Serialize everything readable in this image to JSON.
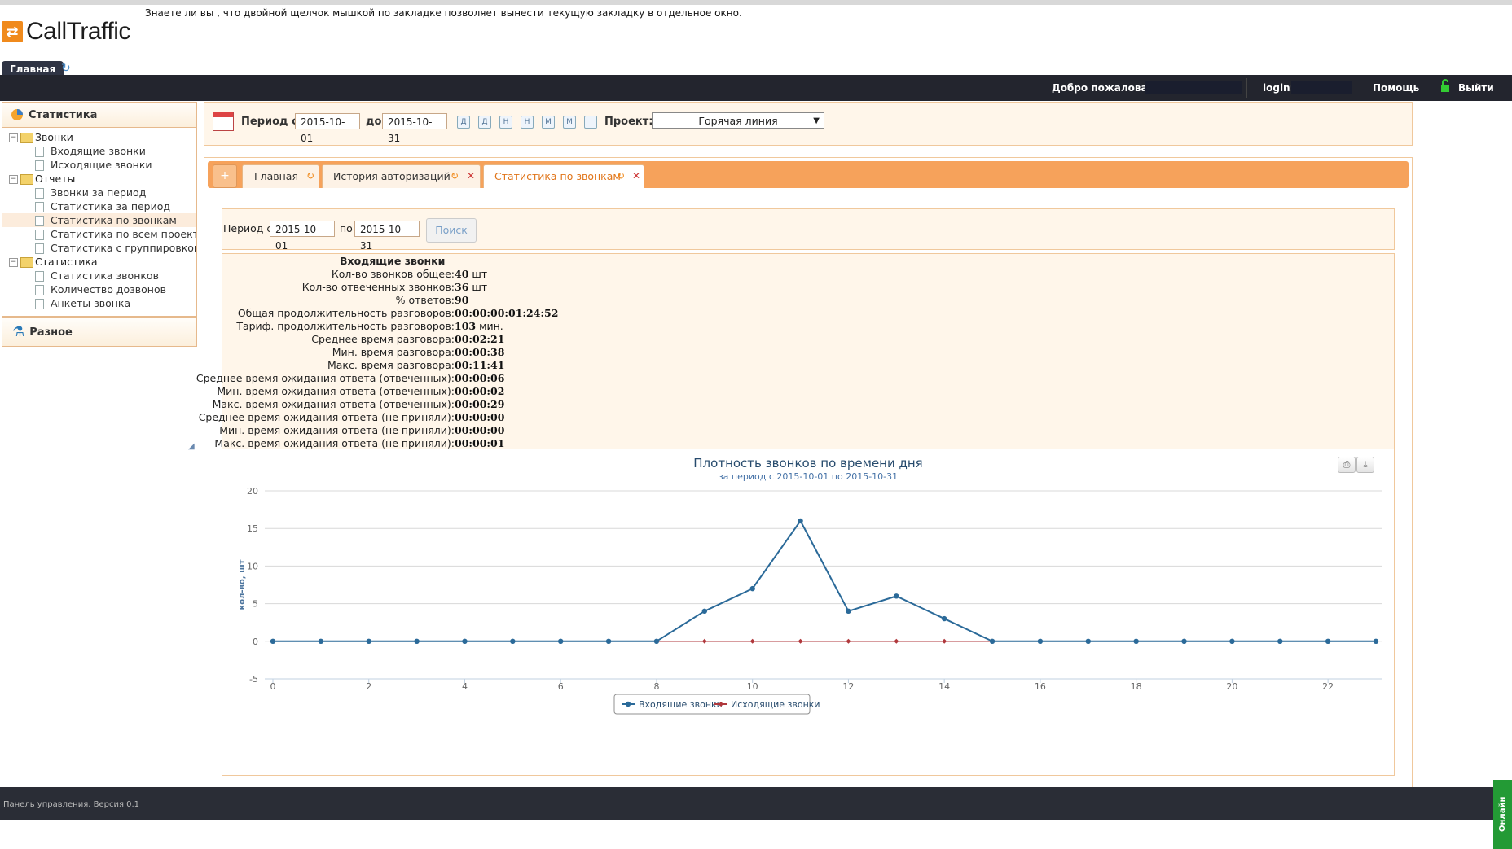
{
  "app": {
    "logo_text": "CallTraffic",
    "tip": "Знаете ли вы , что двойной щелчок мышкой по закладке позволяет вынести текущую закладку в отдельное окно."
  },
  "apptab": {
    "label": "Главная"
  },
  "topbar": {
    "welcome": "Добро пожаловать,",
    "login_label": "login:",
    "help": "Помощь",
    "logout": "Выйти"
  },
  "sidebar": {
    "header": "Статистика",
    "tree": [
      {
        "type": "folder",
        "label": "Звонки"
      },
      {
        "type": "leaf",
        "label": "Входящие звонки"
      },
      {
        "type": "leaf",
        "label": "Исходящие звонки"
      },
      {
        "type": "folder",
        "label": "Отчеты"
      },
      {
        "type": "leaf",
        "label": "Звонки за период"
      },
      {
        "type": "leaf",
        "label": "Статистика за период"
      },
      {
        "type": "leaf",
        "label": "Статистика по звонкам",
        "selected": true
      },
      {
        "type": "leaf",
        "label": "Статистика по всем проектам"
      },
      {
        "type": "leaf",
        "label": "Статистика с группировкой"
      },
      {
        "type": "folder",
        "label": "Статистика"
      },
      {
        "type": "leaf",
        "label": "Статистика звонков"
      },
      {
        "type": "leaf",
        "label": "Количество дозвонов"
      },
      {
        "type": "leaf",
        "label": "Анкеты звонка"
      }
    ],
    "misc": "Разное"
  },
  "period": {
    "label_from": "Период с",
    "from": "2015-10-01",
    "label_to": "до",
    "to": "2015-10-31",
    "quick_buttons": [
      "Д",
      "Д",
      "Н",
      "Н",
      "М",
      "М",
      ""
    ],
    "project_label": "Проект:",
    "project_value": "Горячая линия"
  },
  "tabs": [
    {
      "label": "Главная",
      "closable": false
    },
    {
      "label": "История авторизаций",
      "closable": true
    },
    {
      "label": "Статистика по звонкам",
      "closable": true,
      "active": true
    }
  ],
  "search": {
    "label_from": "Период с",
    "from": "2015-10-01",
    "label_to": "по",
    "to": "2015-10-31",
    "button": "Поиск"
  },
  "stats": {
    "title": "Входящие звонки",
    "rows": [
      {
        "k": "Кол-во звонков общее:",
        "v": "40",
        "u": " шт"
      },
      {
        "k": "Кол-во отвеченных звонков:",
        "v": "36",
        "u": " шт"
      },
      {
        "k": "% ответов:",
        "v": "90",
        "u": ""
      },
      {
        "k": "Общая продолжительность разговоров:",
        "v": "00:00:00:01:24:52",
        "u": ""
      },
      {
        "k": "Тариф. продолжительность разговоров:",
        "v": "103",
        "u": " мин."
      },
      {
        "k": "Среднее время разговора:",
        "v": "00:02:21",
        "u": ""
      },
      {
        "k": "Мин. время разговора:",
        "v": "00:00:38",
        "u": ""
      },
      {
        "k": "Макс. время разговора:",
        "v": "00:11:41",
        "u": ""
      },
      {
        "k": "Среднее время ожидания ответа (отвеченных):",
        "v": "00:00:06",
        "u": ""
      },
      {
        "k": "Мин. время ожидания ответа (отвеченных):",
        "v": "00:00:02",
        "u": ""
      },
      {
        "k": "Макс. время ожидания ответа (отвеченных):",
        "v": "00:00:29",
        "u": ""
      },
      {
        "k": "Среднее время ожидания ответа (не приняли):",
        "v": "00:00:00",
        "u": ""
      },
      {
        "k": "Мин. время ожидания ответа (не приняли):",
        "v": "00:00:00",
        "u": ""
      },
      {
        "k": "Макс. время ожидания ответа (не приняли):",
        "v": "00:00:01",
        "u": ""
      }
    ]
  },
  "chart_data": {
    "type": "line",
    "title": "Плотность звонков по времени дня",
    "subtitle": "за период с 2015-10-01 по 2015-10-31",
    "ylabel": "кол-во, шт",
    "ylim": [
      -5,
      20
    ],
    "yticks": [
      -5,
      0,
      5,
      10,
      15,
      20
    ],
    "x": [
      0,
      1,
      2,
      3,
      4,
      5,
      6,
      7,
      8,
      9,
      10,
      11,
      12,
      13,
      14,
      15,
      16,
      17,
      18,
      19,
      20,
      21,
      22,
      23
    ],
    "xticks": [
      0,
      2,
      4,
      6,
      8,
      10,
      12,
      14,
      16,
      18,
      20,
      22
    ],
    "series": [
      {
        "name": "Входящие звонки",
        "color": "#2b6a99",
        "values": [
          0,
          0,
          0,
          0,
          0,
          0,
          0,
          0,
          0,
          4,
          7,
          16,
          4,
          6,
          3,
          0,
          0,
          0,
          0,
          0,
          0,
          0,
          0,
          0
        ]
      },
      {
        "name": "Исходящие звонки",
        "color": "#b0383c",
        "values": [
          0,
          0,
          0,
          0,
          0,
          0,
          0,
          0,
          0,
          0,
          0,
          0,
          0,
          0,
          0,
          0,
          0,
          0,
          0,
          0,
          0,
          0,
          0,
          0
        ]
      }
    ],
    "legend": "bottom-center"
  },
  "footer": {
    "text": "Панель управления. Версия 0.1",
    "consultant": "Онлайн консультант"
  },
  "icons": [
    "refresh-icon",
    "calendar-icon",
    "print-icon",
    "download-icon",
    "lock-icon",
    "statistics-icon",
    "misc-icon"
  ]
}
